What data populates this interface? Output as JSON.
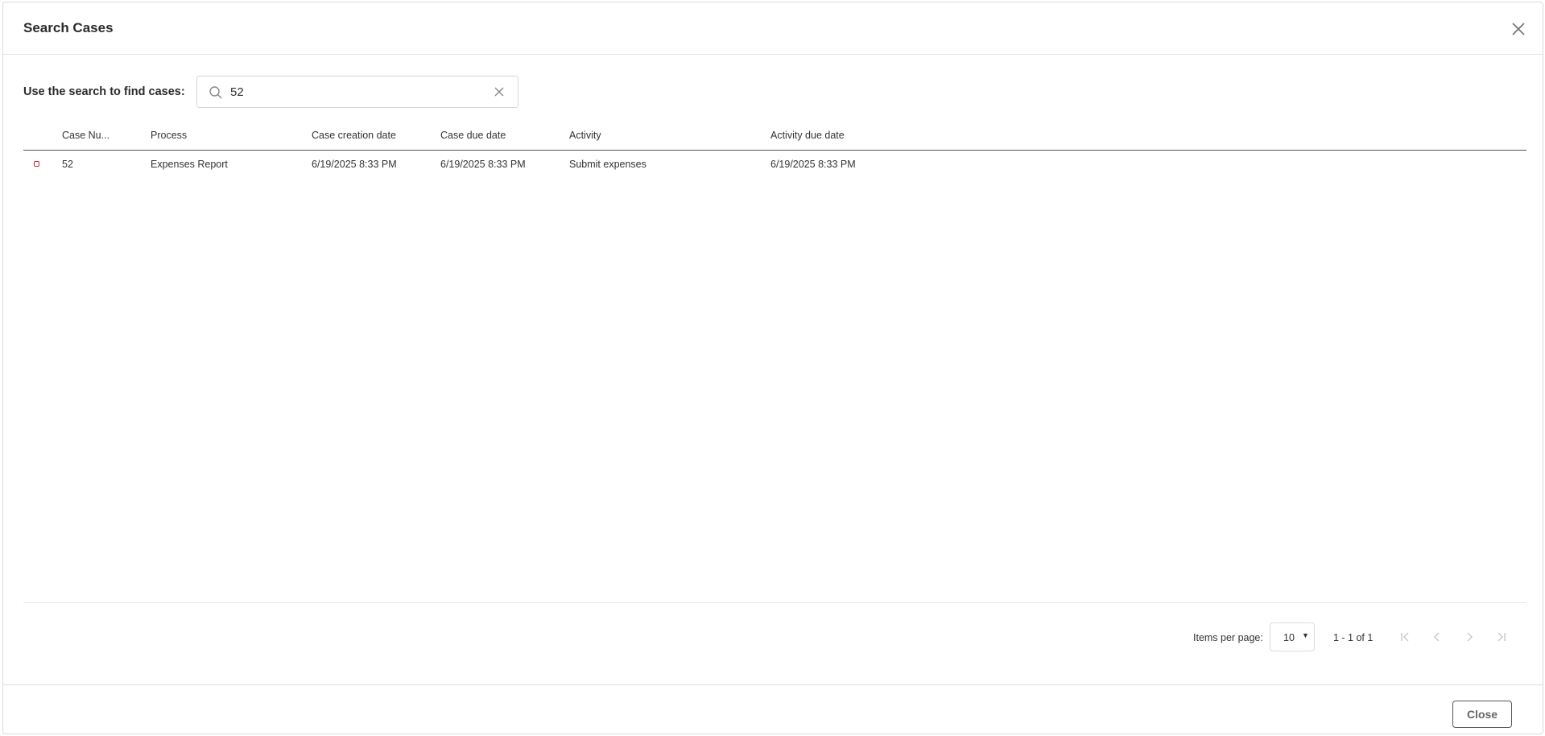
{
  "dialog": {
    "title": "Search Cases",
    "close_icon": "close-icon"
  },
  "search": {
    "label": "Use the search to find cases:",
    "value": "52",
    "search_icon": "search-icon",
    "clear_icon": "clear-icon"
  },
  "table": {
    "columns": [
      "Case Nu...",
      "Process",
      "Case creation date",
      "Case due date",
      "Activity",
      "Activity due date"
    ],
    "rows": [
      {
        "status_icon": "status-indicator-icon",
        "status_color": "#d9222a",
        "case_number": "52",
        "process": "Expenses Report",
        "case_creation_date": "6/19/2025 8:33 PM",
        "case_due_date": "6/19/2025 8:33 PM",
        "activity": "Submit expenses",
        "activity_due_date": "6/19/2025 8:33 PM"
      }
    ]
  },
  "pager": {
    "items_per_page_label": "Items per page:",
    "items_per_page": "10",
    "range": "1 - 1 of 1",
    "nav_icons": [
      "first-page-icon",
      "previous-page-icon",
      "next-page-icon",
      "last-page-icon"
    ]
  },
  "footer": {
    "close_label": "Close"
  }
}
